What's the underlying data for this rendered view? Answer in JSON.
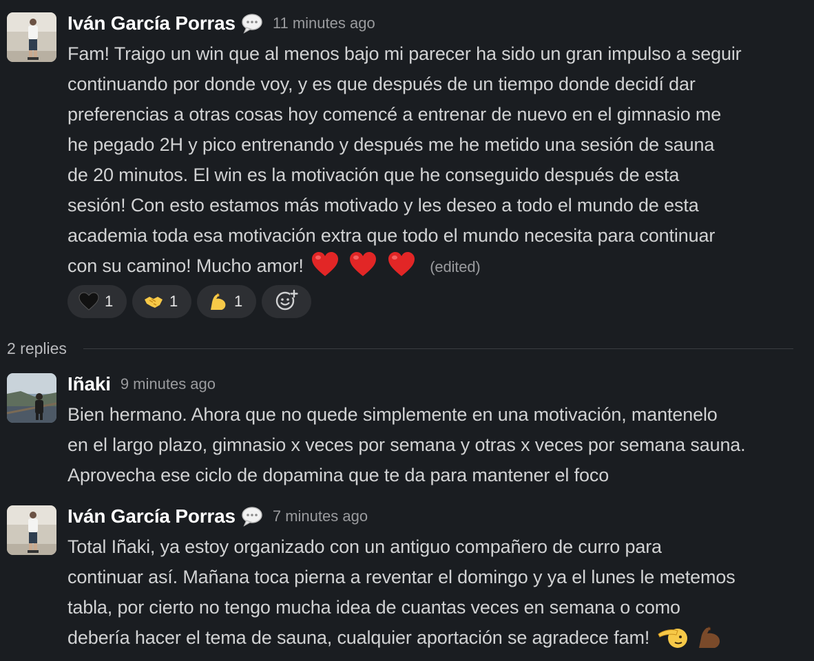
{
  "messages": [
    {
      "author": "Iván García Porras",
      "status_icon": "speech-bubble-icon",
      "time": "11 minutes ago",
      "lines": [
        "Fam! Traigo un win que al menos bajo mi parecer ha sido un gran impulso a seguir",
        "continuando por donde voy, y es que después de un tiempo donde decidí dar",
        "preferencias a otras cosas hoy comencé a entrenar de nuevo en el gimnasio me",
        "he pegado 2H y pico entrenando y después me he metido una sesión de sauna",
        "de 20 minutos. El win es la motivación que he conseguido después de esta",
        "sesión! Con esto estamos más motivado y les deseo a todo el mundo de esta",
        "academia toda esa motivación extra que todo el mundo necesita para continuar",
        "con su camino! Mucho amor!"
      ],
      "trailing_emojis": [
        "red-heart",
        "red-heart",
        "red-heart"
      ],
      "edited_label": "(edited)",
      "reactions": [
        {
          "emoji": "black-heart",
          "count": "1"
        },
        {
          "emoji": "handshake",
          "count": "1"
        },
        {
          "emoji": "flexed-biceps",
          "count": "1"
        }
      ],
      "add_reaction_icon": "add-emoji-icon"
    },
    {
      "author": "Iñaki",
      "time": "9 minutes ago",
      "lines": [
        "Bien hermano. Ahora que no quede simplemente en una motivación, mantenelo",
        "en el largo plazo, gimnasio x veces por semana y otras x veces por semana sauna.",
        "Aprovecha ese ciclo de dopamina que te da para mantener el foco"
      ]
    },
    {
      "author": "Iván García Porras",
      "status_icon": "speech-bubble-icon",
      "time": "7 minutes ago",
      "lines": [
        "Total Iñaki, ya estoy organizado con un antiguo compañero de curro para",
        "continuar así. Mañana toca pierna a reventar el domingo y ya el lunes le metemos",
        "tabla, por cierto no tengo mucha idea de cuantas veces en semana o como",
        "debería hacer el tema de sauna, cualquier aportación se agradece fam!"
      ],
      "trailing_emojis": [
        "saluting-face",
        "flexed-biceps-dark"
      ]
    }
  ],
  "thread": {
    "replies_label": "2 replies"
  },
  "colors": {
    "background": "#1a1d21",
    "text": "#d1d2d3",
    "author": "#ffffff",
    "muted": "#9a9b9e",
    "reaction_bg": "#2d2f33"
  }
}
